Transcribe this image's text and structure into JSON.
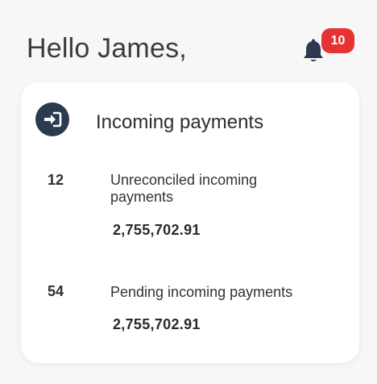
{
  "header": {
    "greeting": "Hello James,",
    "notification_count": "10"
  },
  "card": {
    "title": "Incoming payments",
    "icon": "sign-in-arrow-icon",
    "rows": [
      {
        "count": "12",
        "label": "Unreconciled incoming payments",
        "amount": "2,755,702.91"
      },
      {
        "count": "54",
        "label": "Pending incoming payments",
        "amount": "2,755,702.91"
      }
    ]
  },
  "colors": {
    "badge": "#e53232",
    "icon_circle": "#2b3a4f",
    "bell": "#2b3a4f"
  }
}
